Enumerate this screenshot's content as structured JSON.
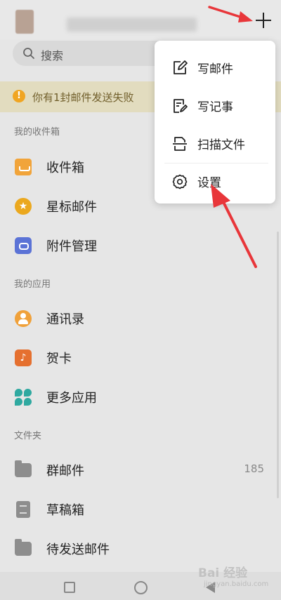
{
  "search": {
    "placeholder": "搜索"
  },
  "banner": {
    "text": "你有1封邮件发送失败"
  },
  "sections": {
    "inbox": "我的收件箱",
    "apps": "我的应用",
    "folders": "文件夹"
  },
  "inbox_items": [
    {
      "label": "收件箱",
      "icon": "inbox-icon"
    },
    {
      "label": "星标邮件",
      "icon": "star-icon"
    },
    {
      "label": "附件管理",
      "icon": "attachment-icon"
    }
  ],
  "app_items": [
    {
      "label": "通讯录",
      "icon": "contacts-icon"
    },
    {
      "label": "贺卡",
      "icon": "greeting-card-icon"
    },
    {
      "label": "更多应用",
      "icon": "more-apps-icon"
    }
  ],
  "folder_items": [
    {
      "label": "群邮件",
      "count": "185",
      "icon": "folder-icon"
    },
    {
      "label": "草稿箱",
      "icon": "drafts-icon"
    },
    {
      "label": "待发送邮件",
      "icon": "folder-icon"
    }
  ],
  "menu": {
    "items": [
      {
        "label": "写邮件",
        "icon": "compose-icon"
      },
      {
        "label": "写记事",
        "icon": "note-icon"
      },
      {
        "label": "扫描文件",
        "icon": "scan-icon"
      },
      {
        "label": "设置",
        "icon": "settings-icon"
      }
    ]
  },
  "watermark": {
    "brand": "Bai 经验",
    "url": "jingyan.baidu.com"
  },
  "colors": {
    "annotation_arrow": "#e8363a",
    "warning": "#f0a522",
    "inbox": "#f1a43a",
    "attachment": "#5b73d6",
    "more_apps": "#2fa9a0"
  }
}
